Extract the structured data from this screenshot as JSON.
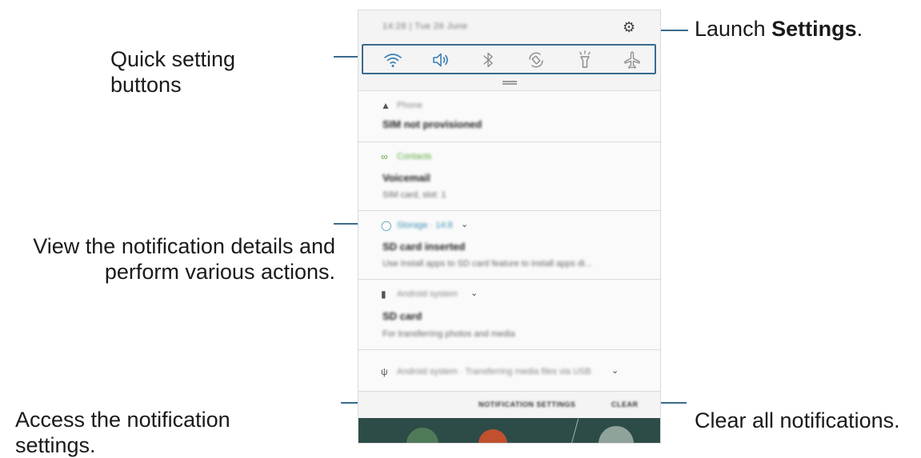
{
  "callouts": {
    "quick_settings_line1": "Quick setting",
    "quick_settings_line2": "buttons",
    "details_line1": "View the notification details and",
    "details_line2": "perform various actions.",
    "access_line1": "Access the notification",
    "access_line2": "settings.",
    "launch_prefix": "Launch ",
    "launch_bold": "Settings",
    "launch_suffix": ".",
    "clear": "Clear all notifications."
  },
  "status_bar": {
    "time_date": "14:28 | Tue 26 June",
    "settings_icon": "gear-icon"
  },
  "quick_settings": [
    {
      "name": "wifi",
      "icon": "wifi-icon",
      "active": true
    },
    {
      "name": "sound",
      "icon": "speaker-icon",
      "active": true
    },
    {
      "name": "bluetooth",
      "icon": "bluetooth-icon",
      "active": false
    },
    {
      "name": "auto-rotate",
      "icon": "rotate-icon",
      "active": false
    },
    {
      "name": "flashlight",
      "icon": "flashlight-icon",
      "active": false
    },
    {
      "name": "airplane-mode",
      "icon": "airplane-icon",
      "active": false
    }
  ],
  "notifications": [
    {
      "app": "Phone",
      "title": "SIM not provisioned",
      "body": "",
      "icon": "sim-icon"
    },
    {
      "app": "Contacts",
      "title": "Voicemail",
      "body": "SIM card, slot: 1",
      "icon": "voicemail-icon"
    },
    {
      "app": "Storage · 14:8",
      "title": "SD card inserted",
      "body": "Use Install apps to SD card feature to install apps di...",
      "icon": "storage-icon"
    },
    {
      "app": "Android system",
      "title": "SD card",
      "body": "For transferring photos and media",
      "icon": "sd-card-icon"
    },
    {
      "app": "Android system · Transferring media files via USB",
      "title": "",
      "body": "",
      "icon": "usb-icon"
    }
  ],
  "actions": {
    "notification_settings": "NOTIFICATION SETTINGS",
    "clear": "CLEAR"
  },
  "colors": {
    "callout_line": "#3a6b8c",
    "qs_active": "#3a7fb5",
    "contacts_accent": "#5aa83a",
    "storage_accent": "#3a8fb5"
  }
}
